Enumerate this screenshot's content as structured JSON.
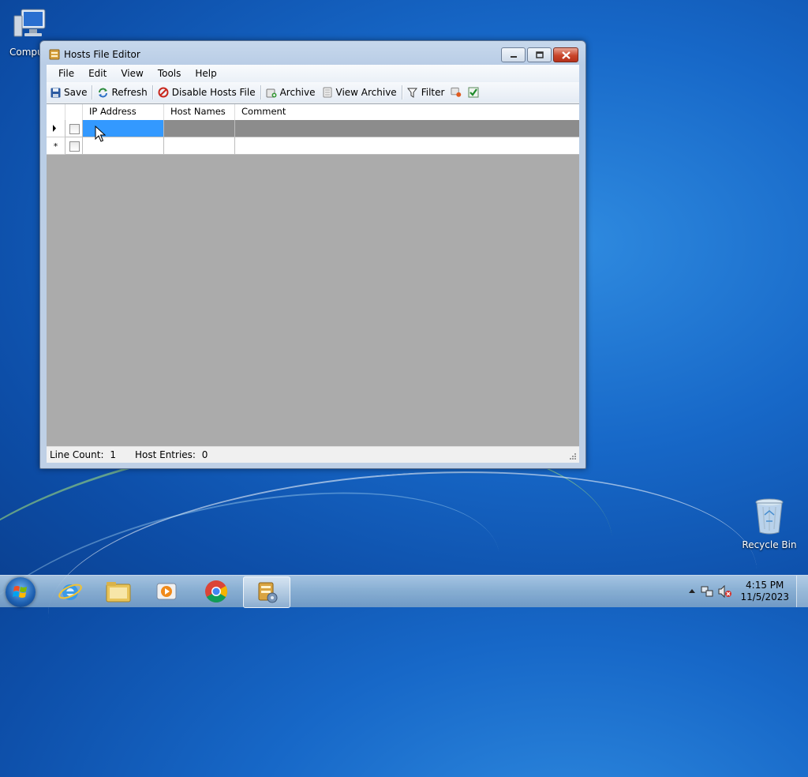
{
  "desktop": {
    "icons": [
      {
        "label": "Compu"
      },
      {
        "label": "Recycle Bin"
      }
    ]
  },
  "window": {
    "title": "Hosts File Editor",
    "menu": [
      "File",
      "Edit",
      "View",
      "Tools",
      "Help"
    ],
    "toolbar": {
      "save": "Save",
      "refresh": "Refresh",
      "disable": "Disable Hosts File",
      "archive": "Archive",
      "view_archive": "View Archive",
      "filter": "Filter"
    },
    "grid": {
      "columns": [
        "IP Address",
        "Host Names",
        "Comment"
      ],
      "rows": [
        {
          "marker": "▶",
          "ip": "",
          "hosts": "",
          "comment": ""
        },
        {
          "marker": "*",
          "ip": "",
          "hosts": "",
          "comment": ""
        }
      ]
    },
    "status": {
      "line_count_label": "Line Count:",
      "line_count": "1",
      "host_entries_label": "Host Entries:",
      "host_entries": "0"
    }
  },
  "taskbar": {
    "apps": [
      "internet-explorer",
      "windows-explorer",
      "media-player",
      "chrome",
      "hosts-file-editor"
    ],
    "time": "4:15 PM",
    "date": "11/5/2023"
  },
  "colors": {
    "selection": "#3399ff",
    "grid_bg": "#ababab",
    "row_dark": "#8c8c8c"
  }
}
